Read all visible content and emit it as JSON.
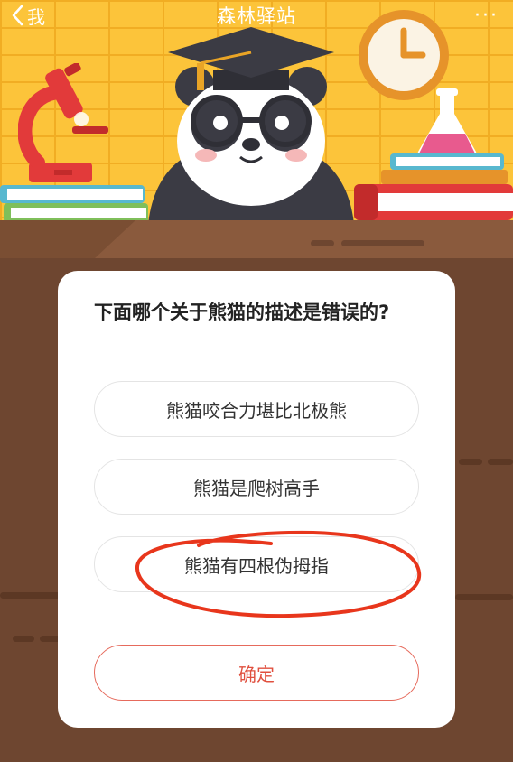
{
  "nav": {
    "back_label": "我",
    "title": "森林驿站",
    "more_label": "···"
  },
  "quiz": {
    "question": "下面哪个关于熊猫的描述是错误的?",
    "options": [
      {
        "label": "熊猫咬合力堪比北极熊"
      },
      {
        "label": "熊猫是爬树高手"
      },
      {
        "label": "熊猫有四根伪拇指"
      }
    ],
    "confirm_label": "确定",
    "circled_option_index": 2
  },
  "colors": {
    "wall": "#fcc43a",
    "desk": "#6e4630",
    "confirm_accent": "#e0503f",
    "annotation_ink": "#e8361c"
  }
}
